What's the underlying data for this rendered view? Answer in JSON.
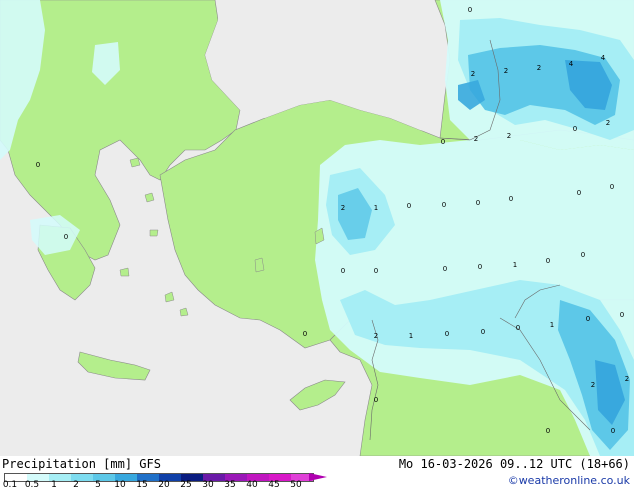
{
  "map": {
    "colors": {
      "land": "#b4ee8c",
      "outside": "#ececec",
      "precip_light": "#d4fbfb",
      "precip_mid": "#a6eef5",
      "precip_heavy": "#5dc8e8",
      "precip_max": "#38a8de",
      "border": "#8a8a8a"
    },
    "values": [
      "0",
      "2",
      "2",
      "2",
      "4",
      "4",
      "2",
      "2",
      "0",
      "2",
      "0",
      "0",
      "0",
      "0",
      "2",
      "1",
      "0",
      "0",
      "0",
      "0",
      "0",
      "0",
      "0",
      "0",
      "0",
      "1",
      "0",
      "0",
      "0",
      "0",
      "2",
      "1",
      "0",
      "0",
      "0",
      "1",
      "0",
      "0",
      "2",
      "0",
      "0",
      "2",
      "2",
      "0"
    ]
  },
  "footer": {
    "title": "Precipitation [mm] GFS",
    "timestamp": "Mo 16-03-2026 09..12 UTC (18+66)",
    "credit": "©weatheronline.co.uk"
  },
  "legend": {
    "labels": [
      "0.1",
      "0.5",
      "1",
      "2",
      "5",
      "10",
      "15",
      "20",
      "25",
      "30",
      "35",
      "40",
      "45",
      "50"
    ],
    "colors": [
      "#ffffff",
      "#d4fbfb",
      "#a6eef5",
      "#7ddcf0",
      "#5dc8e8",
      "#38a8de",
      "#2070c8",
      "#1040a8",
      "#0a1c80",
      "#6a1aa8",
      "#9a18b8",
      "#c016c0",
      "#d818c8",
      "#e040d8"
    ]
  }
}
